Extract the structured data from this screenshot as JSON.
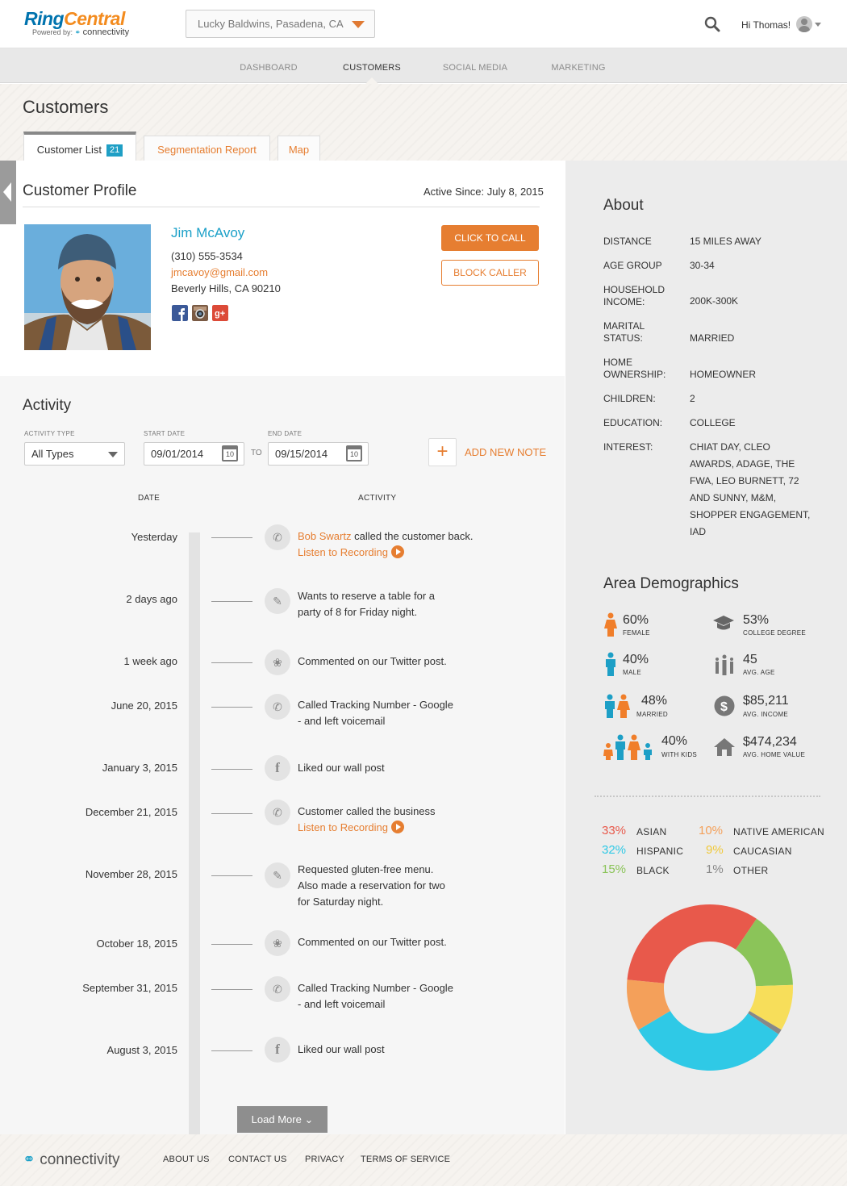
{
  "header": {
    "logo_ring": "Ring",
    "logo_central": "Central",
    "logo_powered": "Powered by:",
    "logo_brand": "connectivity",
    "location": "Lucky Baldwins, Pasadena, CA",
    "greeting": "Hi Thomas!"
  },
  "nav": {
    "items": [
      "DASHBOARD",
      "CUSTOMERS",
      "SOCIAL MEDIA",
      "MARKETING"
    ],
    "active": "CUSTOMERS"
  },
  "page": {
    "title": "Customers",
    "tabs": [
      {
        "label": "Customer List",
        "badge": "21"
      },
      {
        "label": "Segmentation Report"
      },
      {
        "label": "Map"
      }
    ]
  },
  "profile": {
    "heading": "Customer Profile",
    "active_since": "Active Since: July 8, 2015",
    "name": "Jim McAvoy",
    "phone": "(310) 555-3534",
    "email": "jmcavoy@gmail.com",
    "address": "Beverly Hills, CA 90210",
    "call_btn": "CLICK TO CALL",
    "block_btn": "BLOCK CALLER"
  },
  "activity": {
    "heading": "Activity",
    "type_label": "ACTIVITY TYPE",
    "type_value": "All Types",
    "start_label": "START DATE",
    "start_value": "09/01/2014",
    "to_label": "TO",
    "end_label": "END DATE",
    "end_value": "09/15/2014",
    "cal_day": "10",
    "add_note": "ADD NEW NOTE",
    "col_date": "DATE",
    "col_activity": "ACTIVITY",
    "rows": [
      {
        "date": "Yesterday",
        "icon": "phone-icon",
        "link": "Bob Swartz",
        "text": " called the customer back.",
        "listen": "Listen to Recording"
      },
      {
        "date": "2 days ago",
        "icon": "note-icon",
        "text": "Wants to reserve a table for a party of 8 for Friday night."
      },
      {
        "date": "1 week ago",
        "icon": "twitter-icon",
        "text": "Commented on our Twitter post."
      },
      {
        "date": "June 20, 2015",
        "icon": "phone-icon",
        "text": "Called Tracking Number - Google - and left voicemail"
      },
      {
        "date": "January 3, 2015",
        "icon": "facebook-icon",
        "text": "Liked our wall post"
      },
      {
        "date": "December 21, 2015",
        "icon": "phone-icon",
        "text": "Customer called the business",
        "listen": "Listen to Recording"
      },
      {
        "date": "November 28, 2015",
        "icon": "note-icon",
        "text": "Requested gluten-free menu. Also made a reservation for two for Saturday night."
      },
      {
        "date": "October 18, 2015",
        "icon": "twitter-icon",
        "text": "Commented on our Twitter post."
      },
      {
        "date": "September 31, 2015",
        "icon": "phone-icon",
        "text": "Called Tracking Number - Google - and left voicemail"
      },
      {
        "date": "August 3, 2015",
        "icon": "facebook-icon",
        "text": "Liked our wall post"
      }
    ],
    "load_more": "Load More"
  },
  "about": {
    "heading": "About",
    "items": [
      {
        "label": "DISTANCE",
        "value": "15 MILES AWAY"
      },
      {
        "label": "AGE GROUP",
        "value": "30-34"
      },
      {
        "label": "HOUSEHOLD INCOME:",
        "value": "200K-300K"
      },
      {
        "label": "MARITAL STATUS:",
        "value": "MARRIED"
      },
      {
        "label": "HOME OWNERSHIP:",
        "value": "HOMEOWNER"
      },
      {
        "label": "CHILDREN:",
        "value": "2"
      },
      {
        "label": "EDUCATION:",
        "value": "COLLEGE"
      },
      {
        "label": "INTEREST:",
        "value": "CHIAT DAY, CLEO AWARDS, ADAGE, THE FWA, LEO BURNETT, 72 AND SUNNY, M&M, SHOPPER ENGAGEMENT, IAD"
      }
    ]
  },
  "demographics": {
    "heading": "Area Demographics",
    "stats": [
      {
        "value": "60%",
        "label": "FEMALE",
        "icon": "female-icon"
      },
      {
        "value": "53%",
        "label": "COLLEGE DEGREE",
        "icon": "graduation-cap-icon"
      },
      {
        "value": "40%",
        "label": "MALE",
        "icon": "male-icon"
      },
      {
        "value": "45",
        "label": "AVG. AGE",
        "icon": "people-age-icon"
      },
      {
        "value": "48%",
        "label": "MARRIED",
        "icon": "couple-icon"
      },
      {
        "value": "$85,211",
        "label": "AVG. INCOME",
        "icon": "dollar-icon"
      },
      {
        "value": "40%",
        "label": "WITH KIDS",
        "icon": "family-icon"
      },
      {
        "value": "$474,234",
        "label": "AVG. HOME VALUE",
        "icon": "house-icon"
      }
    ],
    "ethnicity": [
      {
        "pct": "33%",
        "label": "ASIAN",
        "color": "#e8594b",
        "value": 33
      },
      {
        "pct": "10%",
        "label": "NATIVE AMERICAN",
        "color": "#f4a05a",
        "value": 10
      },
      {
        "pct": "32%",
        "label": "HISPANIC",
        "color": "#2fc9e6",
        "value": 32
      },
      {
        "pct": "9%",
        "label": "CAUCASIAN",
        "color": "#f7de5a",
        "value": 9
      },
      {
        "pct": "15%",
        "label": "BLACK",
        "color": "#8bc459",
        "value": 15
      },
      {
        "pct": "1%",
        "label": "OTHER",
        "color": "#888888",
        "value": 1
      }
    ]
  },
  "chart_data": {
    "type": "pie",
    "categories": [
      "ASIAN",
      "NATIVE AMERICAN",
      "HISPANIC",
      "CAUCASIAN",
      "BLACK",
      "OTHER"
    ],
    "values": [
      33,
      10,
      32,
      9,
      15,
      1
    ],
    "colors": [
      "#e8594b",
      "#f4a05a",
      "#2fc9e6",
      "#f7de5a",
      "#8bc459",
      "#888888"
    ]
  },
  "footer": {
    "brand": "connectivity",
    "links": [
      "ABOUT US",
      "CONTACT US",
      "PRIVACY",
      "TERMS OF SERVICE"
    ]
  }
}
